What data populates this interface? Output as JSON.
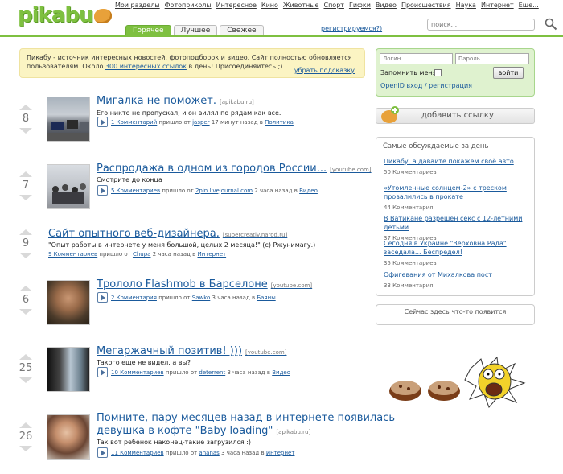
{
  "header": {
    "logo": "pikabu",
    "nav": [
      "Мои разделы",
      "Фотоприколы",
      "Интересное",
      "Кино",
      "Животные",
      "Спорт",
      "Гифки",
      "Видео",
      "Происшествия",
      "Наука",
      "Интернет",
      "Еще..."
    ],
    "tabs": [
      "Горячее",
      "Лучшее",
      "Свежее"
    ],
    "register": "регистрируемся?)",
    "search_placeholder": "поиск..."
  },
  "intro": {
    "text1": "Пикабу - источник интересных новостей, фотоподборок и видео. Сайт полностью обновляется пользователям. Около ",
    "link": "300 интересных ссылок",
    "text2": " в день! Присоединяйтесь ;)",
    "hide": "убрать подсказку"
  },
  "posts": [
    {
      "score": "8",
      "title": "Мигалка не поможет.",
      "source": "[apikabu.ru]",
      "desc": "Его никто не пропускал, и он вилял по рядам как все.",
      "comments": "1 Комментарий",
      "pre": "пришло от",
      "user": "jasper",
      "time": "17 минут назад в",
      "section": "Политика"
    },
    {
      "score": "7",
      "title": "Распродажа в одном из городов России...",
      "source": "[youtube.com]",
      "desc": "Смотрите до конца",
      "comments": "5 Комментариев",
      "pre": "пришло от",
      "user": "2pin.livejournal.com",
      "time": "2 часа назад в",
      "section": "Видео"
    },
    {
      "score": "9",
      "title": "Сайт опытного веб-дизайнера.",
      "source": "[supercreativ.narod.ru]",
      "desc": "\"Опыт работы в интернете у меня большой, целых 2 месяца!\" (c) Ржунимагу.)",
      "comments": "9 Комментариев",
      "pre": "пришло от",
      "user": "Chupa",
      "time": "2 часа назад в",
      "section": "Интернет"
    },
    {
      "score": "6",
      "title": "Трололо Flashmob в Барселоне",
      "source": "[youtube.com]",
      "desc": "",
      "comments": "2 Комментария",
      "pre": "пришло от",
      "user": "Sawko",
      "time": "3 часа назад в",
      "section": "Баяны"
    },
    {
      "score": "25",
      "title": "Мегаржачный позитив! )))",
      "source": "[youtube.com]",
      "desc": "Такого еще не видел. а вы?",
      "comments": "10 Комментариев",
      "pre": "пришло от",
      "user": "deterrent",
      "time": "3 часа назад в",
      "section": "Видео"
    },
    {
      "score": "26",
      "title": "Помните, пару месяцев назад в интернете появилась",
      "title2": "девушка в кофте \"Baby loading\"",
      "source": "[apikabu.ru]",
      "desc": "Так вот ребенок наконец-такие загрузился :)",
      "comments": "11 Комментариев",
      "pre": "пришло от",
      "user": "ananas",
      "time": "3 часа назад в",
      "section": "Интернет"
    }
  ],
  "login": {
    "login_placeholder": "Логин",
    "password_placeholder": "Пароль",
    "remember": "Запомнить меня",
    "enter": "войти",
    "openid": "OpenID вход",
    "sep": " / ",
    "register": "регистрация"
  },
  "addlink": "добавить ссылку",
  "discussed": {
    "title": "Самые обсуждаемые за день",
    "items": [
      {
        "title": "Пикабу, а давайте покажем своё авто",
        "count": "50 Комментариев"
      },
      {
        "title": "«Утомленные солнцем-2» с треском провалились в прокате",
        "count": "44 Комментария"
      },
      {
        "title": "В Ватикане разрешен секс с 12-летними детьми",
        "count": "37 Комментариев"
      },
      {
        "title": "Сегодня в Украине \"Верховна Рада\" заседала... Беспредел!",
        "count": "35 Комментариев"
      },
      {
        "title": "Офигевания от Михалкова пост",
        "count": "33 Комментария"
      }
    ]
  },
  "appear_text": "Сейчас здесь что-то появится"
}
